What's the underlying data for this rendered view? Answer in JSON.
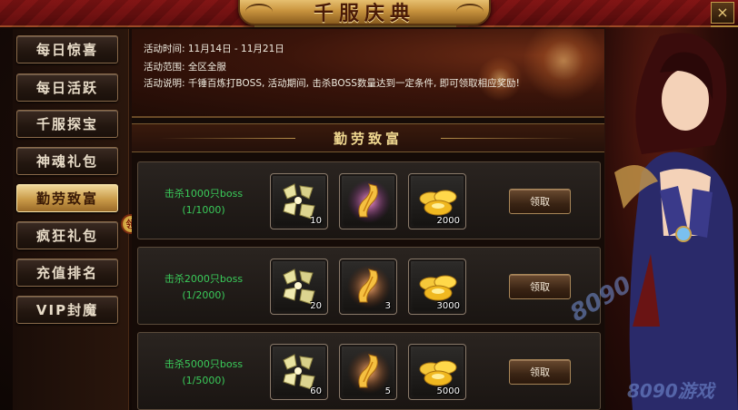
{
  "window": {
    "title": "千服庆典",
    "close_label": "×"
  },
  "sidebar": {
    "items": [
      {
        "label": "每日惊喜",
        "active": false
      },
      {
        "label": "每日活跃",
        "active": false
      },
      {
        "label": "千服探宝",
        "active": false
      },
      {
        "label": "神魂礼包",
        "active": false
      },
      {
        "label": "勤劳致富",
        "active": true
      },
      {
        "label": "疯狂礼包",
        "active": false
      },
      {
        "label": "充值排名",
        "active": false
      },
      {
        "label": "VIP封魔",
        "active": false
      }
    ],
    "badge": "领"
  },
  "info": {
    "time": "活动时间: 11月14日 - 11月21日",
    "scope": "活动范围: 全区全服",
    "desc": "活动说明: 千锤百炼打BOSS, 活动期间, 击杀BOSS数量达到一定条件, 即可领取相应奖励!"
  },
  "section": {
    "title": "勤劳致富"
  },
  "rewards": [
    {
      "condition": "击杀1000只boss",
      "progress": "(1/1000)",
      "items": [
        {
          "icon": "jade-shards-icon",
          "qty": "10"
        },
        {
          "icon": "scroll-icon",
          "qty": ""
        },
        {
          "icon": "gold-ingot-icon",
          "qty": "2000"
        }
      ],
      "button": "领取"
    },
    {
      "condition": "击杀2000只boss",
      "progress": "(1/2000)",
      "items": [
        {
          "icon": "jade-shards-icon",
          "qty": "20"
        },
        {
          "icon": "scroll-icon",
          "qty": "3"
        },
        {
          "icon": "gold-ingot-icon",
          "qty": "3000"
        }
      ],
      "button": "领取"
    },
    {
      "condition": "击杀5000只boss",
      "progress": "(1/5000)",
      "items": [
        {
          "icon": "jade-shards-icon",
          "qty": "60"
        },
        {
          "icon": "scroll-icon",
          "qty": "5"
        },
        {
          "icon": "gold-ingot-icon",
          "qty": "5000"
        }
      ],
      "button": "领取"
    }
  ],
  "watermark": {
    "line1": "8090",
    "line2": "8090游戏"
  },
  "colors": {
    "accent_gold": "#c9943e",
    "condition_green": "#3acb5a",
    "banner_red": "#7a1414"
  }
}
